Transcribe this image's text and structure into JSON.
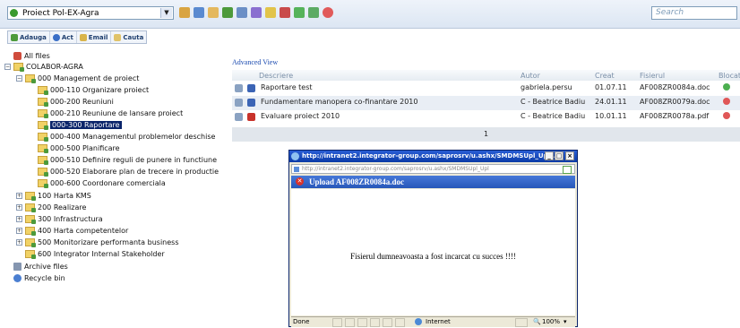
{
  "project": {
    "name": "Proiect Pol-EX-Agra"
  },
  "search": {
    "placeholder": "Search"
  },
  "toolbar": {
    "adauga": "Adauga",
    "act": "Act",
    "email": "Email",
    "cauta": "Cauta"
  },
  "tree": {
    "all_files": "All files",
    "root": "COLABOR-AGRA",
    "n000": "000 Management de proiect",
    "n000_110": "000-110 Organizare proiect",
    "n000_200": "000-200 Reuniuni",
    "n000_210": "000-210 Reuniune de lansare proiect",
    "n000_300": "000-300 Raportare",
    "n000_400": "000-400 Managementul problemelor deschise",
    "n000_500": "000-500 Planificare",
    "n000_510": "000-510 Definire reguli de punere in functiune",
    "n000_520": "000-520 Elaborare plan de trecere in productie",
    "n000_600": "000-600 Coordonare comerciala",
    "n100": "100 Harta KMS",
    "n200": "200 Realizare",
    "n300": "300 Infrastructura",
    "n400": "400 Harta competentelor",
    "n500": "500 Monitorizare performanta business",
    "n600": "600 Integrator Internal Stakeholder",
    "archive": "Archive files",
    "recycle": "Recycle bin"
  },
  "view": {
    "advanced": "Advanced View"
  },
  "grid": {
    "headers": {
      "descriere": "Descriere",
      "autor": "Autor",
      "creat": "Creat",
      "fisierul": "Fisierul",
      "blocat": "Blocat"
    },
    "rows": [
      {
        "descriere": "Raportare test",
        "autor": "gabriela.persu",
        "creat": "01.07.11",
        "fisierul": "AF008ZR0084a.doc"
      },
      {
        "descriere": "Fundamentare manopera co-finantare 2010",
        "autor": "C - Beatrice Badiu",
        "creat": "24.01.11",
        "fisierul": "AF008ZR0079a.doc"
      },
      {
        "descriere": "Evaluare proiect 2010",
        "autor": "C - Beatrice Badiu",
        "creat": "10.01.11",
        "fisierul": "AF008ZR0078a.pdf"
      }
    ],
    "page": "1"
  },
  "popup": {
    "title": "http://intranet2.integrator-group.com/saprosrv/u.ashx/SMDMSUpl_Upl...",
    "address": "http://intranet2.integrator-group.com/saprosrv/u.ashx/SMDMSUpl_Upl",
    "header": "Upload  AF008ZR0084a.doc",
    "message": "Fisierul dumneavoasta a fost incarcat cu succes !!!!",
    "status_done": "Done",
    "zone": "Internet",
    "zoom": "100%"
  },
  "colors": {
    "accent": "#0a246a",
    "lock_open": "#4caf50",
    "lock_closed": "#e05757"
  }
}
